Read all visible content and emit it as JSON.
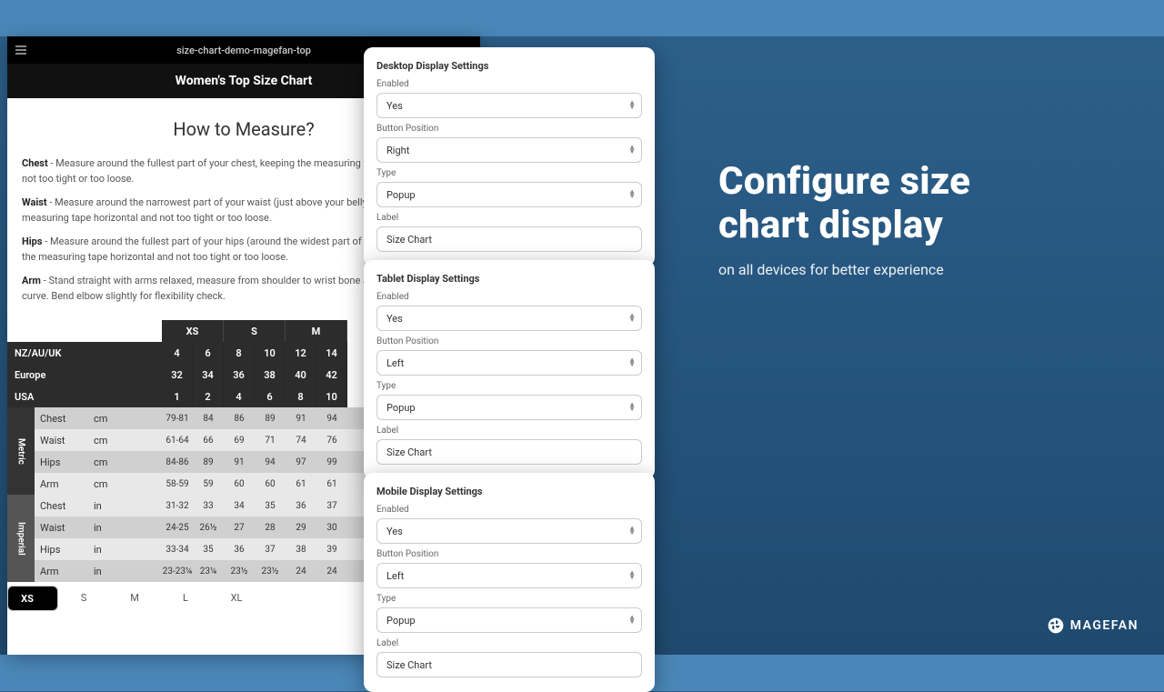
{
  "shot": {
    "url": "size-chart-demo-magefan-top",
    "title": "Women's Top Size Chart",
    "howto": "How to Measure?",
    "p_chest_b": "Chest",
    "p_chest": " - Measure around the fullest part of your chest, keeping the measuring tape horizontal and not too tight or too loose.",
    "p_waist_b": "Waist",
    "p_waist": " - Measure around the narrowest part of your waist (just above your belly button) keeping the measuring tape horizontal and not too tight or too loose.",
    "p_hips_b": "Hips",
    "p_hips": " - Measure around the fullest part of your hips (around the widest part of your buttocks) keeping the measuring tape horizontal and not too tight or too loose.",
    "p_arm_b": "Arm",
    "p_arm": " - Stand straight with arms relaxed, measure from shoulder to wrist bone along arm's natural curve. Bend elbow slightly for flexibility check."
  },
  "sizes": {
    "cols": [
      "XS",
      "S",
      "M"
    ]
  },
  "regions": [
    {
      "label": "NZ/AU/UK",
      "vals": [
        "4",
        "6",
        "8",
        "10",
        "12",
        "14"
      ]
    },
    {
      "label": "Europe",
      "vals": [
        "32",
        "34",
        "36",
        "38",
        "40",
        "42"
      ]
    },
    {
      "label": "USA",
      "vals": [
        "1",
        "2",
        "4",
        "6",
        "8",
        "10"
      ]
    }
  ],
  "metric": [
    {
      "n": "Chest",
      "u": "cm",
      "v": [
        "79-81",
        "84",
        "86",
        "89",
        "91",
        "94"
      ]
    },
    {
      "n": "Waist",
      "u": "cm",
      "v": [
        "61-64",
        "66",
        "69",
        "71",
        "74",
        "76"
      ]
    },
    {
      "n": "Hips",
      "u": "cm",
      "v": [
        "84-86",
        "89",
        "91",
        "94",
        "97",
        "99"
      ]
    },
    {
      "n": "Arm",
      "u": "cm",
      "v": [
        "58-59",
        "59",
        "60",
        "60",
        "61",
        "61"
      ]
    }
  ],
  "imperial": [
    {
      "n": "Chest",
      "u": "in",
      "v": [
        "31-32",
        "33",
        "34",
        "35",
        "36",
        "37"
      ]
    },
    {
      "n": "Waist",
      "u": "in",
      "v": [
        "24-25",
        "26½",
        "27",
        "28",
        "29",
        "30"
      ]
    },
    {
      "n": "Hips",
      "u": "in",
      "v": [
        "33-34",
        "35",
        "36",
        "37",
        "38",
        "39"
      ]
    },
    {
      "n": "Arm",
      "u": "in",
      "v": [
        "23-23¼",
        "23¼",
        "23½",
        "23½",
        "24",
        "24"
      ]
    }
  ],
  "btabs": [
    "XS",
    "S",
    "M",
    "L",
    "XL"
  ],
  "syslabel": {
    "metric": "Metric",
    "imperial": "Imperial"
  },
  "cards": [
    {
      "title": "Desktop Display Settings",
      "fields": {
        "enabled_l": "Enabled",
        "enabled_v": "Yes",
        "pos_l": "Button Position",
        "pos_v": "Right",
        "type_l": "Type",
        "type_v": "Popup",
        "label_l": "Label",
        "label_v": "Size Chart"
      }
    },
    {
      "title": "Tablet Display Settings",
      "fields": {
        "enabled_l": "Enabled",
        "enabled_v": "Yes",
        "pos_l": "Button Position",
        "pos_v": "Left",
        "type_l": "Type",
        "type_v": "Popup",
        "label_l": "Label",
        "label_v": "Size Chart"
      }
    },
    {
      "title": "Mobile Display Settings",
      "fields": {
        "enabled_l": "Enabled",
        "enabled_v": "Yes",
        "pos_l": "Button Position",
        "pos_v": "Left",
        "type_l": "Type",
        "type_v": "Popup",
        "label_l": "Label",
        "label_v": "Size Chart"
      }
    }
  ],
  "mk": {
    "h1a": "Configure size",
    "h1b": "chart display",
    "sub": "on all devices for better experience"
  },
  "brand": "MAGEFAN"
}
